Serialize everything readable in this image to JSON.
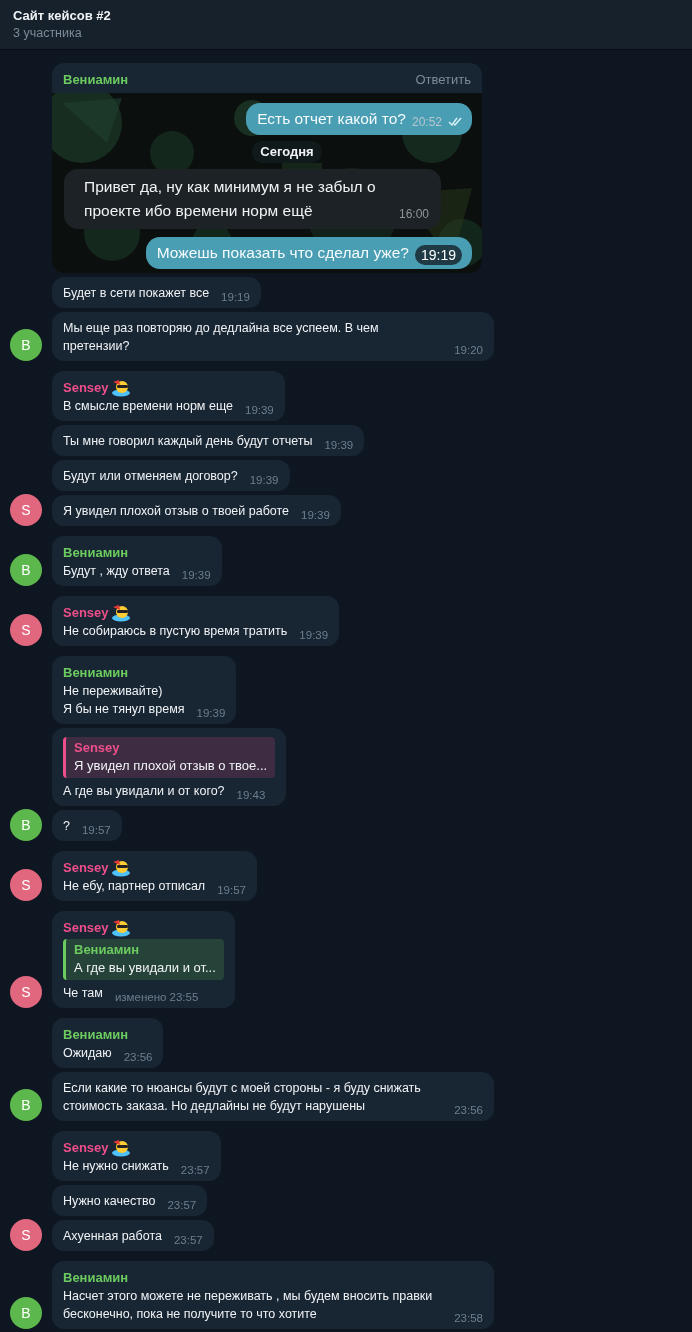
{
  "header": {
    "title": "Сайт кейсов #2",
    "subtitle": "3 участника"
  },
  "groups": [
    {
      "avatar": {
        "letter": "В",
        "color": "#5cb84c"
      },
      "messages": [
        {
          "kind": "screenshot",
          "name": {
            "text": "Вениамин",
            "color": "#6ccb5f",
            "emoji_status": false
          },
          "action": "Ответить",
          "items": [
            {
              "kind": "out",
              "text": "Есть отчет какой то?",
              "time": "20:52",
              "read": true
            },
            {
              "kind": "date",
              "text": "Сегодня"
            },
            {
              "kind": "in",
              "text": "Привет да, ну как минимум я не забыл о проекте ибо времени норм ещё",
              "time": "16:00"
            },
            {
              "kind": "out",
              "text": "Можешь показать что сделал уже?",
              "time": "19:19"
            }
          ]
        },
        {
          "kind": "text",
          "text": "Будет в сети покажет все",
          "time": "19:19"
        },
        {
          "kind": "text",
          "text": "Мы еще раз повторяю до дедлайна все успеем. В чем претензии?",
          "time": "19:20"
        }
      ]
    },
    {
      "avatar": {
        "letter": "S",
        "color": "#e0677e"
      },
      "messages": [
        {
          "kind": "text",
          "name": {
            "text": "Sensey",
            "color": "#ee4f8a",
            "emoji_status": true
          },
          "text": "В смысле времени норм еще",
          "time": "19:39"
        },
        {
          "kind": "text",
          "text": "Ты мне говорил каждый день будут отчеты",
          "time": "19:39"
        },
        {
          "kind": "text",
          "text": "Будут или отменяем договор?",
          "time": "19:39"
        },
        {
          "kind": "text",
          "text": "Я увидел плохой отзыв о твоей работе",
          "time": "19:39"
        }
      ]
    },
    {
      "avatar": {
        "letter": "В",
        "color": "#5cb84c"
      },
      "messages": [
        {
          "kind": "text",
          "name": {
            "text": "Вениамин",
            "color": "#6ccb5f",
            "emoji_status": false
          },
          "text": "Будут , жду ответа",
          "time": "19:39"
        }
      ]
    },
    {
      "avatar": {
        "letter": "S",
        "color": "#e0677e"
      },
      "messages": [
        {
          "kind": "text",
          "name": {
            "text": "Sensey",
            "color": "#ee4f8a",
            "emoji_status": true
          },
          "text": "Не собираюсь в пустую время тратить",
          "time": "19:39"
        }
      ]
    },
    {
      "avatar": {
        "letter": "В",
        "color": "#5cb84c"
      },
      "messages": [
        {
          "kind": "text",
          "name": {
            "text": "Вениамин",
            "color": "#6ccb5f",
            "emoji_status": false
          },
          "text": "Не переживайте)\nЯ бы не тянул время",
          "time": "19:39"
        },
        {
          "kind": "text",
          "reply": {
            "name": "Sensey",
            "text": "Я увидел плохой отзыв о твое...",
            "color": "#ee4f8a"
          },
          "text": "А где вы увидали и от кого?",
          "time": "19:43"
        },
        {
          "kind": "text",
          "text": "?",
          "time": "19:57"
        }
      ]
    },
    {
      "avatar": {
        "letter": "S",
        "color": "#e0677e"
      },
      "messages": [
        {
          "kind": "text",
          "name": {
            "text": "Sensey",
            "color": "#ee4f8a",
            "emoji_status": true
          },
          "text": "Не ебу, партнер отписал",
          "time": "19:57"
        }
      ]
    },
    {
      "avatar": {
        "letter": "S",
        "color": "#e0677e"
      },
      "messages": [
        {
          "kind": "text",
          "name": {
            "text": "Sensey",
            "color": "#ee4f8a",
            "emoji_status": true
          },
          "reply": {
            "name": "Вениамин",
            "text": "А где вы увидали и от...",
            "color": "#6ccb5f"
          },
          "text": "Че там",
          "time": "изменено 23:55"
        }
      ]
    },
    {
      "avatar": {
        "letter": "В",
        "color": "#5cb84c"
      },
      "messages": [
        {
          "kind": "text",
          "name": {
            "text": "Вениамин",
            "color": "#6ccb5f",
            "emoji_status": false
          },
          "text": "Ожидаю",
          "time": "23:56"
        },
        {
          "kind": "text",
          "text": "Если какие то нюансы будут с моей стороны - я буду снижать стоимость заказа. Но дедлайны не будут нарушены",
          "time": "23:56"
        }
      ]
    },
    {
      "avatar": {
        "letter": "S",
        "color": "#e0677e"
      },
      "messages": [
        {
          "kind": "text",
          "name": {
            "text": "Sensey",
            "color": "#ee4f8a",
            "emoji_status": true
          },
          "text": "Не нужно снижать",
          "time": "23:57"
        },
        {
          "kind": "text",
          "text": "Нужно качество",
          "time": "23:57"
        },
        {
          "kind": "text",
          "text": "Ахуенная работа",
          "time": "23:57"
        }
      ]
    },
    {
      "avatar": {
        "letter": "В",
        "color": "#5cb84c"
      },
      "messages": [
        {
          "kind": "text",
          "name": {
            "text": "Вениамин",
            "color": "#6ccb5f",
            "emoji_status": false
          },
          "text": "Насчет этого можете не переживать , мы будем вносить правки бесконечно, пока не получите то что хотите",
          "time": "23:58"
        }
      ]
    }
  ]
}
